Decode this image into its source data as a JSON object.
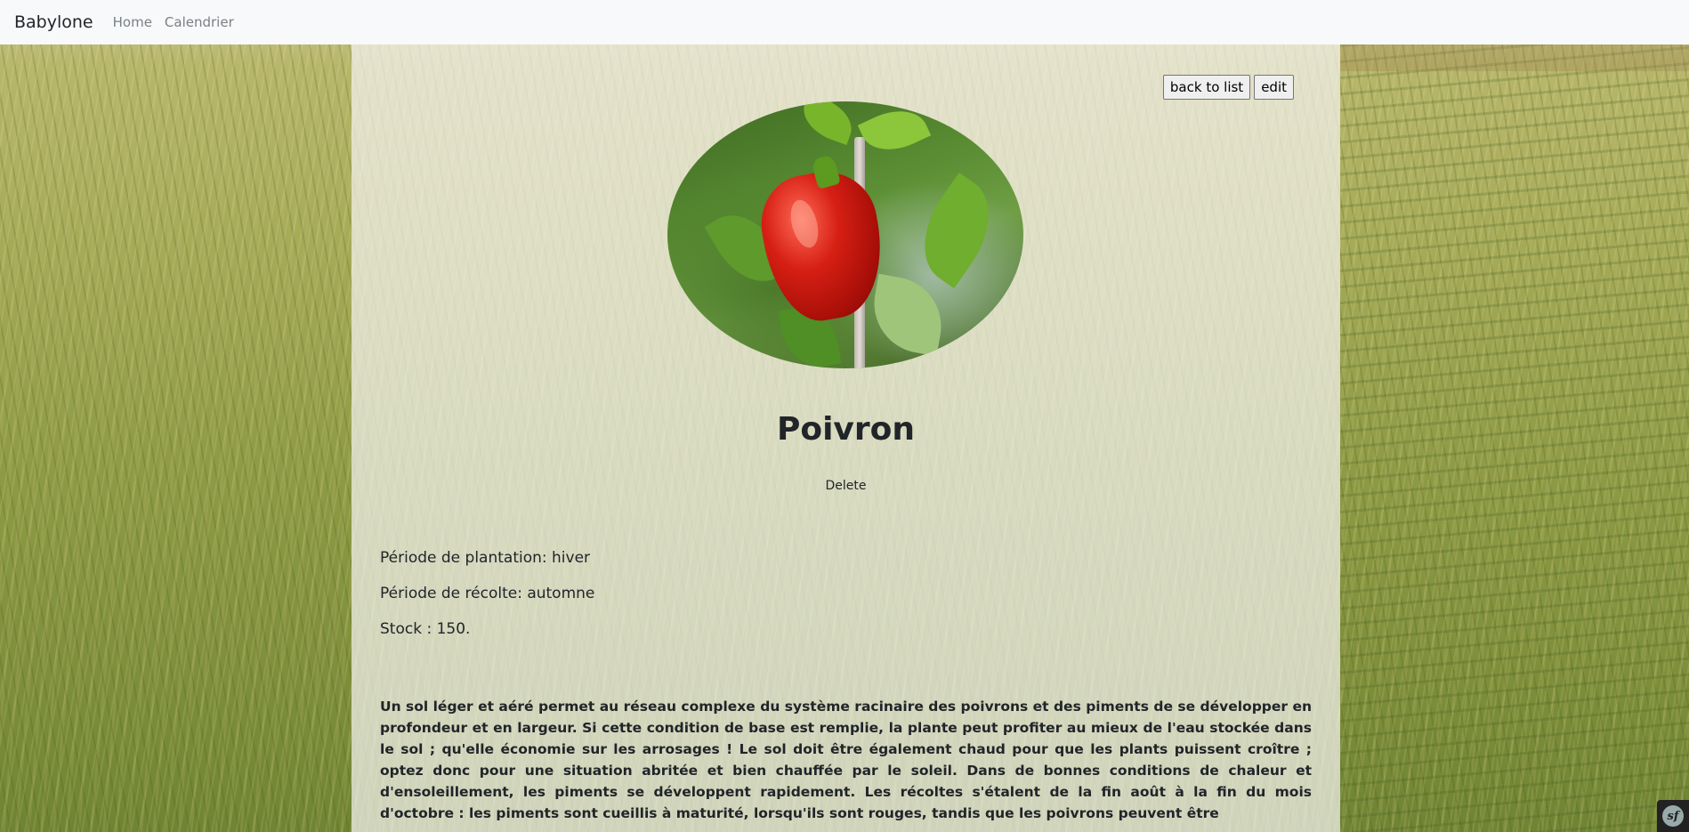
{
  "navbar": {
    "brand": "Babylone",
    "links": [
      {
        "label": "Home"
      },
      {
        "label": "Calendrier"
      }
    ]
  },
  "actions": {
    "back_label": "back to list",
    "edit_label": "edit",
    "delete_label": "Delete"
  },
  "product": {
    "name": "Poivron",
    "planting": "Période de plantation: hiver",
    "harvest": "Période de récolte: automne",
    "stock": "Stock : 150.",
    "description": "Un sol léger et aéré permet au réseau complexe du système racinaire des poivrons et des piments de se développer en profondeur et en largeur. Si cette condition de base est remplie, la plante peut profiter au mieux de l'eau stockée dans le sol ; qu'elle économie sur les arrosages ! Le sol doit être également chaud pour que les plants puissent croître ; optez donc pour une situation abritée et bien chauffée par le soleil. Dans de bonnes conditions de chaleur et d'ensoleillement, les piments se développent rapidement. Les récoltes s'étalent de la fin août à la fin du mois d'octobre : les piments sont cueillis à maturité, lorsqu'ils sont rouges, tandis que les poivrons peuvent être"
  },
  "debug_toolbar": {
    "logo_text": "sf"
  },
  "colors": {
    "navbar_bg": "#f8f9fa",
    "text": "#212529",
    "nav_link": "#7a7f85"
  }
}
